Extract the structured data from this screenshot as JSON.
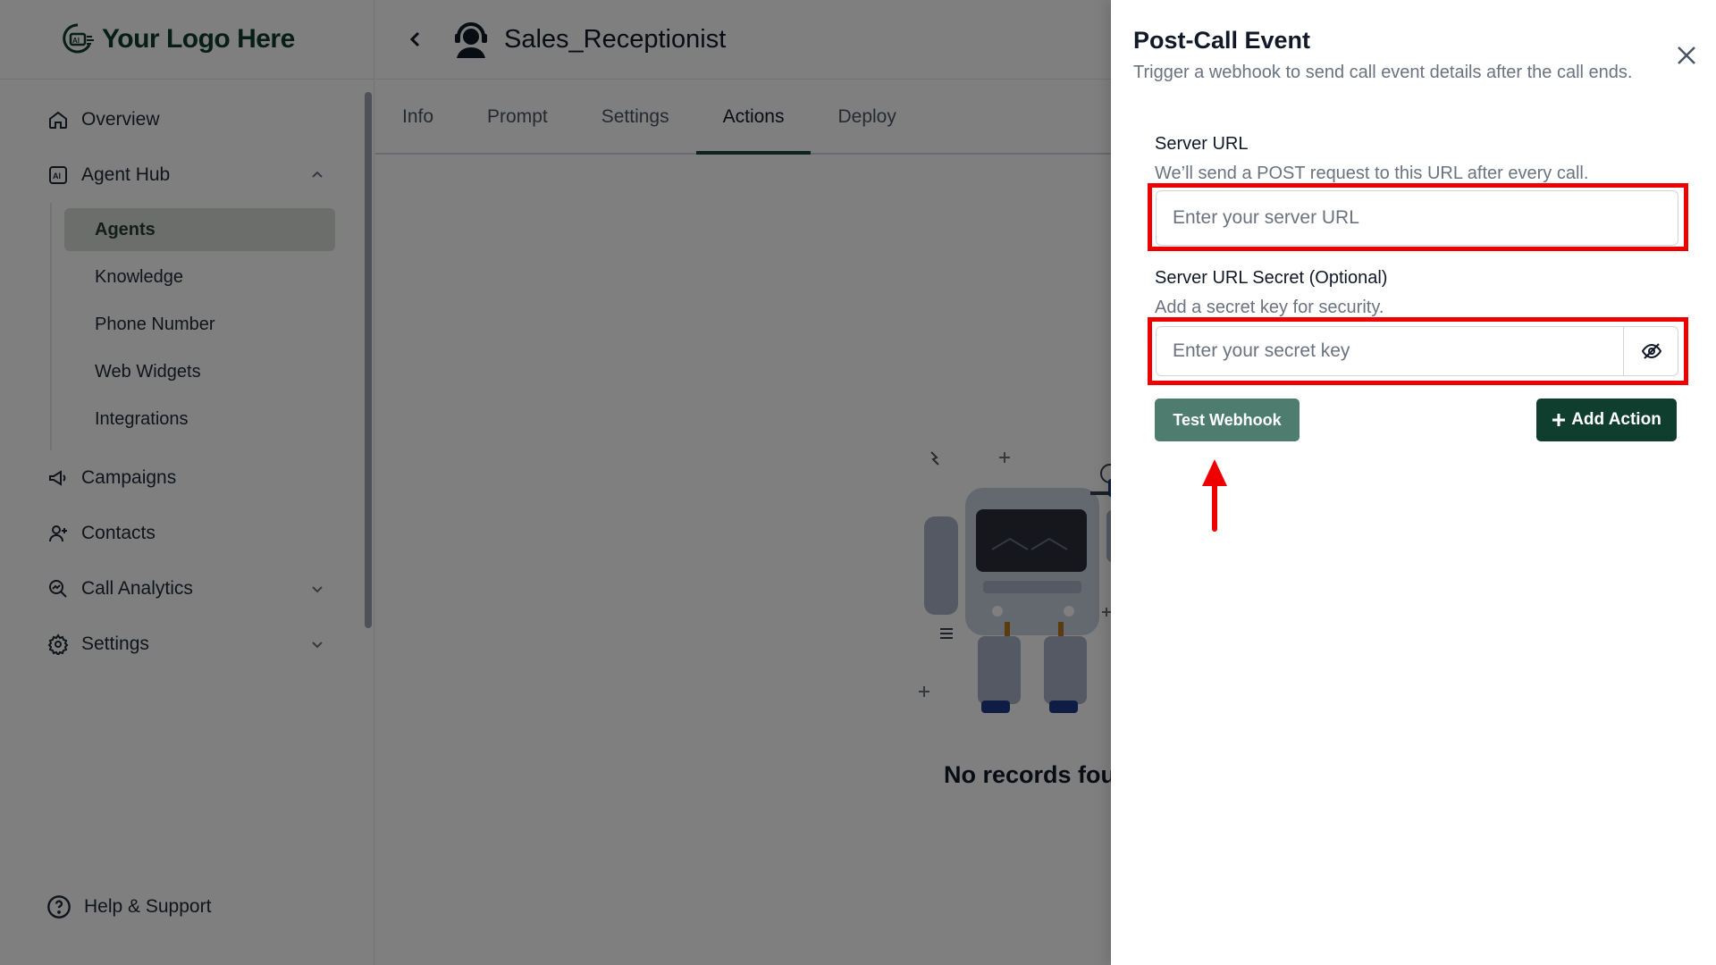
{
  "brand": {
    "logo_text": "Your Logo Here",
    "primary_color": "#0f3d2e",
    "accent_color": "#4e7d6f"
  },
  "sidebar": {
    "items": [
      {
        "label": "Overview",
        "icon": "home-icon"
      },
      {
        "label": "Agent Hub",
        "icon": "ai-agent-icon",
        "expanded": true
      },
      {
        "label": "Campaigns",
        "icon": "megaphone-icon"
      },
      {
        "label": "Contacts",
        "icon": "add-user-icon"
      },
      {
        "label": "Call Analytics",
        "icon": "analytics-icon"
      },
      {
        "label": "Settings",
        "icon": "gear-icon"
      }
    ],
    "agent_hub_children": [
      {
        "label": "Agents",
        "active": true
      },
      {
        "label": "Knowledge"
      },
      {
        "label": "Phone Number"
      },
      {
        "label": "Web Widgets"
      },
      {
        "label": "Integrations"
      }
    ],
    "help_label": "Help & Support"
  },
  "header": {
    "agent_name": "Sales_Receptionist"
  },
  "tabs": [
    {
      "label": "Info"
    },
    {
      "label": "Prompt"
    },
    {
      "label": "Settings"
    },
    {
      "label": "Actions",
      "active": true
    },
    {
      "label": "Deploy"
    }
  ],
  "main": {
    "empty_text": "No records fou"
  },
  "drawer": {
    "title": "Post-Call Event",
    "subtitle": "Trigger a webhook to send call event details after the call ends.",
    "server_url": {
      "label": "Server URL",
      "help": "We’ll send a POST request to this URL after every call.",
      "placeholder": "Enter your server URL",
      "value": ""
    },
    "secret": {
      "label": "Server URL Secret (Optional)",
      "help": "Add a secret key for security.",
      "placeholder": "Enter your secret key",
      "value": ""
    },
    "test_button": "Test Webhook",
    "add_button": "Add Action",
    "highlight_color": "#ee0000"
  }
}
